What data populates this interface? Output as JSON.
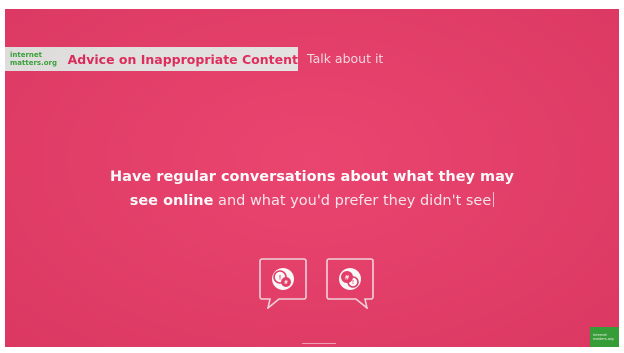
{
  "banner": {
    "logo_line1": "internet",
    "logo_line2": "matters.org",
    "title": "Advice on Inappropriate Content"
  },
  "section_label": "Talk about it",
  "headline": {
    "line1": "Have regular conversations about what they may",
    "line2_bold": "see online",
    "line2_rest": " and what you'd prefer they didn't see"
  },
  "icons": [
    "chat-bubble-icon",
    "chat-bubble-icon"
  ],
  "corner_badge": {
    "line1": "Internet",
    "line2": "matters.org"
  },
  "colors": {
    "background": "#e83b68",
    "banner": "#e9e6e6",
    "brand_green": "#3aa83a",
    "title_pink": "#e2295a"
  }
}
